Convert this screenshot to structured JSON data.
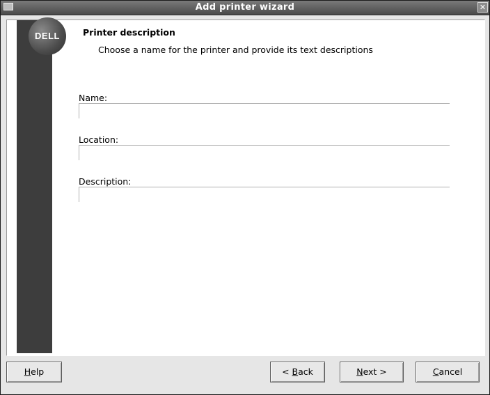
{
  "window": {
    "title": "Add printer wizard"
  },
  "logo": {
    "text": "DELL"
  },
  "page": {
    "heading": "Printer description",
    "subheading": "Choose a name for the printer and provide its text descriptions"
  },
  "fields": {
    "name": {
      "label": "Name:",
      "value": ""
    },
    "location": {
      "label": "Location:",
      "value": ""
    },
    "description": {
      "label": "Description:",
      "value": ""
    }
  },
  "buttons": {
    "help": {
      "pre": "",
      "mnemonic": "H",
      "post": "elp"
    },
    "back": {
      "pre": "< ",
      "mnemonic": "B",
      "post": "ack"
    },
    "next": {
      "pre": "",
      "mnemonic": "N",
      "post": "ext >"
    },
    "cancel": {
      "pre": "",
      "mnemonic": "C",
      "post": "ancel"
    }
  }
}
